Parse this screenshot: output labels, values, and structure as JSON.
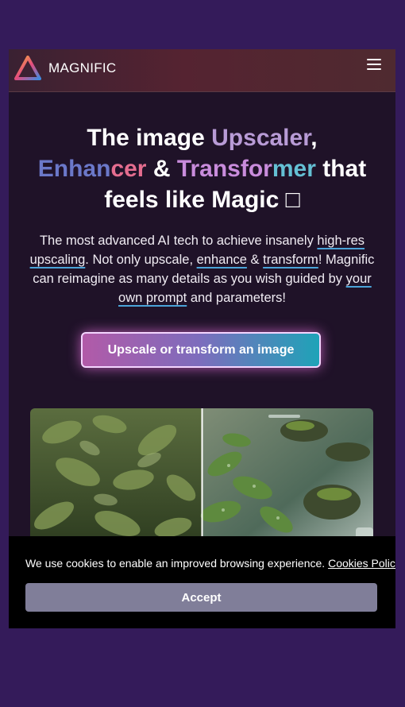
{
  "header": {
    "brand": "MAGNIFIC",
    "logo_icon": "magnific-triangle-logo-icon",
    "menu_icon": "hamburger-menu-icon"
  },
  "hero": {
    "title_part1": "The image ",
    "title_upscaler": "Upscaler",
    "title_comma": ",",
    "title_enh_a": "Enhan",
    "title_enh_b": "cer",
    "title_amp": " & ",
    "title_trans_a": "Transfor",
    "title_trans_b": "mer",
    "title_that": " that",
    "title_line3": "feels like Magic □",
    "sub_1": "The most advanced AI tech to achieve insanely ",
    "sub_link1": "high-res upscaling",
    "sub_2": ". Not only upscale, ",
    "sub_link2": "enhance",
    "sub_3": " & ",
    "sub_link3": "transform",
    "sub_4": "! Magnific can reimagine as many details as you wish guided by ",
    "sub_link4": "your own prompt",
    "sub_5": " and parameters!"
  },
  "cta": {
    "label": "Upscale or transform an image"
  },
  "comparison": {
    "image": "before-after-jungle-river-image"
  },
  "cookie": {
    "text": "We use cookies to enable an improved browsing experience.",
    "link": "Cookies Policy",
    "accept": "Accept"
  },
  "colors": {
    "page_bg": "#341b5a",
    "content_bg": "#1f1228",
    "accent_pink": "#b25aa8",
    "accent_teal": "#1ea3b8"
  }
}
